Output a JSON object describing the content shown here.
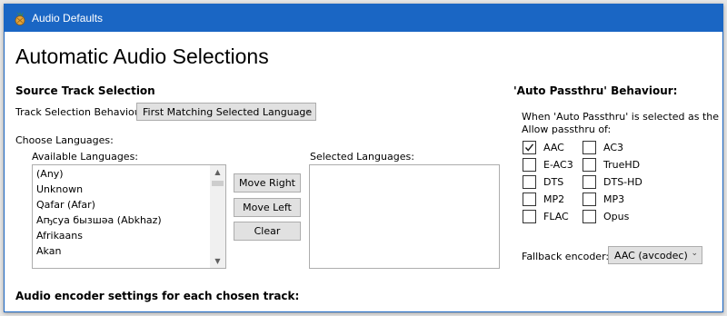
{
  "window": {
    "title": "Audio Defaults"
  },
  "page": {
    "heading": "Automatic Audio Selections"
  },
  "source_track": {
    "section_title": "Source Track Selection",
    "behaviour_label": "Track Selection Behaviour:",
    "behaviour_value": "First Matching Selected Language",
    "choose_languages_label": "Choose Languages:",
    "available_label": "Available Languages:",
    "selected_label": "Selected Languages:",
    "available_languages": [
      "(Any)",
      "Unknown",
      "Qafar (Afar)",
      "Аҧсуа бызшәа (Abkhaz)",
      "Afrikaans",
      "Akan"
    ],
    "selected_languages": [],
    "buttons": {
      "move_right": "Move Right",
      "move_left": "Move Left",
      "clear": "Clear"
    }
  },
  "passthru": {
    "section_title": "'Auto Passthru' Behaviour:",
    "description_line1": "When 'Auto Passthru' is selected as the audi",
    "description_line2": "Allow passthru of:",
    "codecs": [
      {
        "label": "AAC",
        "checked": true
      },
      {
        "label": "AC3",
        "checked": false
      },
      {
        "label": "E-AC3",
        "checked": false
      },
      {
        "label": "TrueHD",
        "checked": false
      },
      {
        "label": "DTS",
        "checked": false
      },
      {
        "label": "DTS-HD",
        "checked": false
      },
      {
        "label": "MP2",
        "checked": false
      },
      {
        "label": "MP3",
        "checked": false
      },
      {
        "label": "FLAC",
        "checked": false
      },
      {
        "label": "Opus",
        "checked": false
      }
    ],
    "fallback_label": "Fallback encoder:",
    "fallback_value": "AAC (avcodec)"
  },
  "encoder": {
    "section_title": "Audio encoder settings for each chosen track:"
  },
  "colors": {
    "titlebar": "#1a66c4",
    "window_bg": "#ffffff",
    "button_bg": "#e1e1e1"
  },
  "icons": {
    "app": "pineapple-app-icon",
    "dropdown": "chevron-down-icon",
    "check": "checkmark-icon"
  }
}
